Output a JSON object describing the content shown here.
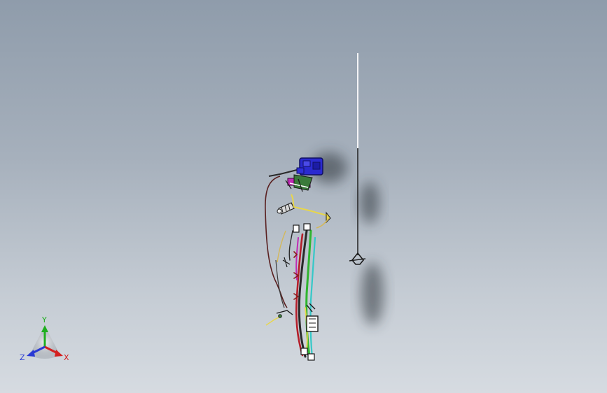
{
  "viewport": {
    "background_top": "#8f9cab",
    "background_bottom": "#d6dbe1"
  },
  "model": {
    "parts": [
      {
        "name": "antenna-mast",
        "icon": "antenna-icon"
      },
      {
        "name": "wire-harness-assembly",
        "icon": "wire-harness-icon"
      },
      {
        "name": "connector-block",
        "icon": "connector-icon"
      }
    ],
    "colors": {
      "connector_blue": "#2a2acf",
      "harness_green": "#2fb52f",
      "harness_cyan": "#35c8c8",
      "harness_red": "#b51f2b",
      "harness_yellow": "#e8d64a",
      "harness_magenta": "#c02bb5",
      "wire_dark": "#4a2a2a"
    }
  },
  "triad": {
    "x_label": "X",
    "y_label": "Y",
    "z_label": "Z",
    "x_color": "#d42020",
    "y_color": "#1fae1f",
    "z_color": "#2a3ad4"
  }
}
